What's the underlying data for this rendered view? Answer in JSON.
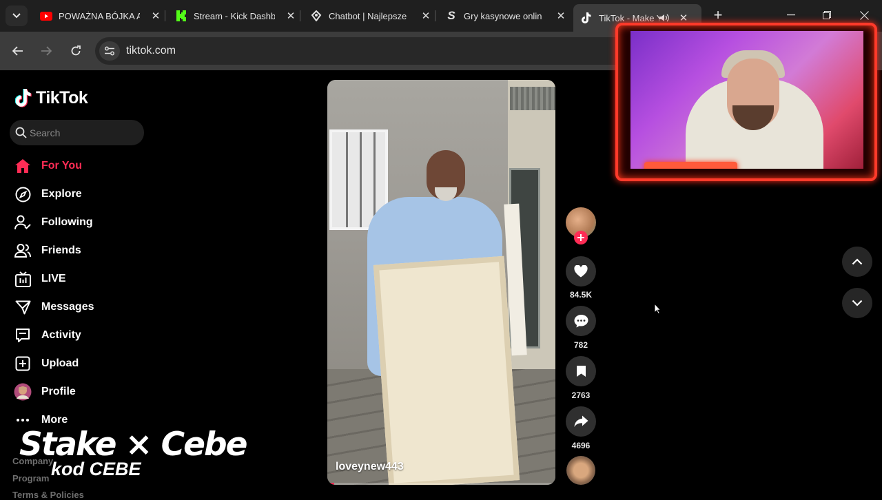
{
  "browser": {
    "tabs": [
      {
        "title": "POWAŻNA BÓJKA A",
        "favicon": "youtube-icon",
        "color": "#ff0000"
      },
      {
        "title": "Stream - Kick Dashb",
        "favicon": "kick-icon",
        "color": "#53fc18"
      },
      {
        "title": "Chatbot | Najlepsze",
        "favicon": "botrix-icon",
        "color": "#e3e3e3"
      },
      {
        "title": "Gry kasynowe onlin",
        "favicon": "stake-s-icon",
        "color": "#e3e3e3"
      },
      {
        "title": "TikTok - Make Y",
        "favicon": "tiktok-icon",
        "color": "#ffffff",
        "active": true
      }
    ],
    "url": "tiktok.com"
  },
  "tiktok": {
    "logo_text": "TikTok",
    "search_placeholder": "Search",
    "nav": [
      {
        "label": "For You",
        "icon": "home-icon",
        "active": true
      },
      {
        "label": "Explore",
        "icon": "compass-icon"
      },
      {
        "label": "Following",
        "icon": "following-icon"
      },
      {
        "label": "Friends",
        "icon": "friends-icon"
      },
      {
        "label": "LIVE",
        "icon": "live-icon"
      },
      {
        "label": "Messages",
        "icon": "messages-icon"
      },
      {
        "label": "Activity",
        "icon": "activity-icon"
      },
      {
        "label": "Upload",
        "icon": "upload-icon"
      },
      {
        "label": "Profile",
        "icon": "profile-avatar"
      },
      {
        "label": "More",
        "icon": "more-icon"
      }
    ],
    "footer": [
      "Company",
      "Program",
      "Terms & Policies"
    ],
    "accent": "#fe2c55",
    "video": {
      "username": "loveynew443",
      "progress": 0.03
    },
    "actions": {
      "likes": "84.5K",
      "comments": "782",
      "saves": "2763",
      "shares": "4696"
    }
  },
  "overlay": {
    "sponsor_line1": "Stake × Cebe",
    "sponsor_line2": "kod CEBE"
  }
}
